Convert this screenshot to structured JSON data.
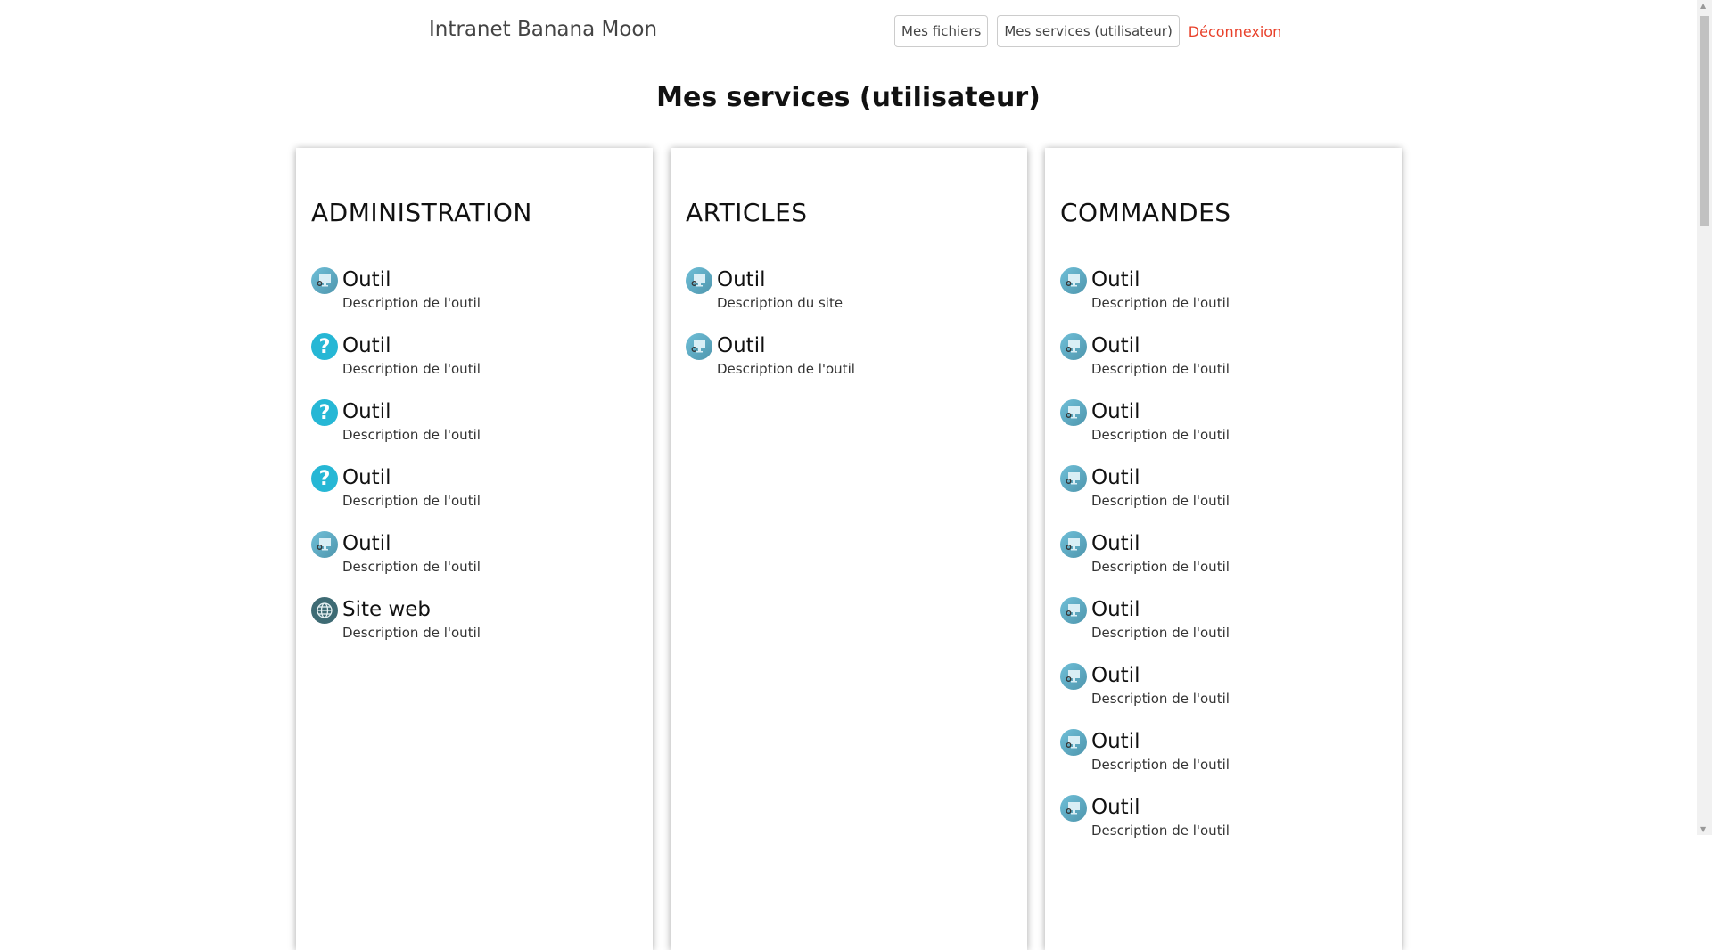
{
  "header": {
    "brand": "Intranet Banana Moon",
    "nav": [
      "Mes fichiers",
      "Mes services (utilisateur)"
    ],
    "logout": "Déconnexion"
  },
  "page_title": "Mes services (utilisateur)",
  "columns": [
    {
      "title": "ADMINISTRATION",
      "items": [
        {
          "icon": "screen",
          "name": "Outil",
          "desc": "Description de l'outil"
        },
        {
          "icon": "help",
          "name": "Outil",
          "desc": "Description de l'outil"
        },
        {
          "icon": "help",
          "name": "Outil",
          "desc": "Description de l'outil"
        },
        {
          "icon": "help",
          "name": "Outil",
          "desc": "Description de l'outil"
        },
        {
          "icon": "screen",
          "name": "Outil",
          "desc": "Description de l'outil"
        },
        {
          "icon": "globe",
          "name": "Site web",
          "desc": "Description de l'outil"
        }
      ]
    },
    {
      "title": "ARTICLES",
      "items": [
        {
          "icon": "screen",
          "name": "Outil",
          "desc": "Description du site"
        },
        {
          "icon": "screen",
          "name": "Outil",
          "desc": "Description de l'outil"
        }
      ]
    },
    {
      "title": "COMMANDES",
      "items": [
        {
          "icon": "screen",
          "name": "Outil",
          "desc": "Description de l'outil"
        },
        {
          "icon": "screen",
          "name": "Outil",
          "desc": "Description de l'outil"
        },
        {
          "icon": "screen",
          "name": "Outil",
          "desc": "Description de l'outil"
        },
        {
          "icon": "screen",
          "name": "Outil",
          "desc": "Description de l'outil"
        },
        {
          "icon": "screen",
          "name": "Outil",
          "desc": "Description de l'outil"
        },
        {
          "icon": "screen",
          "name": "Outil",
          "desc": "Description de l'outil"
        },
        {
          "icon": "screen",
          "name": "Outil",
          "desc": "Description de l'outil"
        },
        {
          "icon": "screen",
          "name": "Outil",
          "desc": "Description de l'outil"
        },
        {
          "icon": "screen",
          "name": "Outil",
          "desc": "Description de l'outil"
        }
      ]
    }
  ]
}
